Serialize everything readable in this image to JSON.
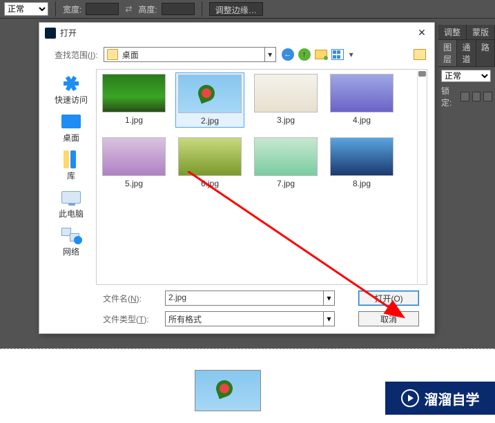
{
  "toolbar": {
    "mode_select": "正常",
    "width_label": "宽度:",
    "height_label": "高度:",
    "refine_label": "调整边缘…"
  },
  "panels": {
    "tab_adjust": "调整",
    "tab_mask": "蒙版",
    "tab_layers": "图层",
    "tab_channels": "通道",
    "tab_paths": "路",
    "blend_mode": "正常",
    "lock_label": "锁定:"
  },
  "dialog": {
    "title": "打开",
    "lookup_label_pre": "查找范围(",
    "lookup_label_u": "I",
    "lookup_label_post": "):",
    "lookup_value": "桌面",
    "places": {
      "quick": "快速访问",
      "desktop": "桌面",
      "libraries": "库",
      "thispc": "此电脑",
      "network": "网络"
    },
    "files": [
      {
        "name": "1.jpg"
      },
      {
        "name": "2.jpg"
      },
      {
        "name": "3.jpg"
      },
      {
        "name": "4.jpg"
      },
      {
        "name": "5.jpg"
      },
      {
        "name": "6.jpg"
      },
      {
        "name": "7.jpg"
      },
      {
        "name": "8.jpg"
      }
    ],
    "filename_label_pre": "文件名(",
    "filename_label_u": "N",
    "filename_label_post": "):",
    "filename_value": "2.jpg",
    "filetype_label_pre": "文件类型(",
    "filetype_label_u": "T",
    "filetype_label_post": "):",
    "filetype_value": "所有格式",
    "open_btn": "打开(O)",
    "cancel_btn": "取消"
  },
  "brand": {
    "text": "溜溜自学"
  }
}
